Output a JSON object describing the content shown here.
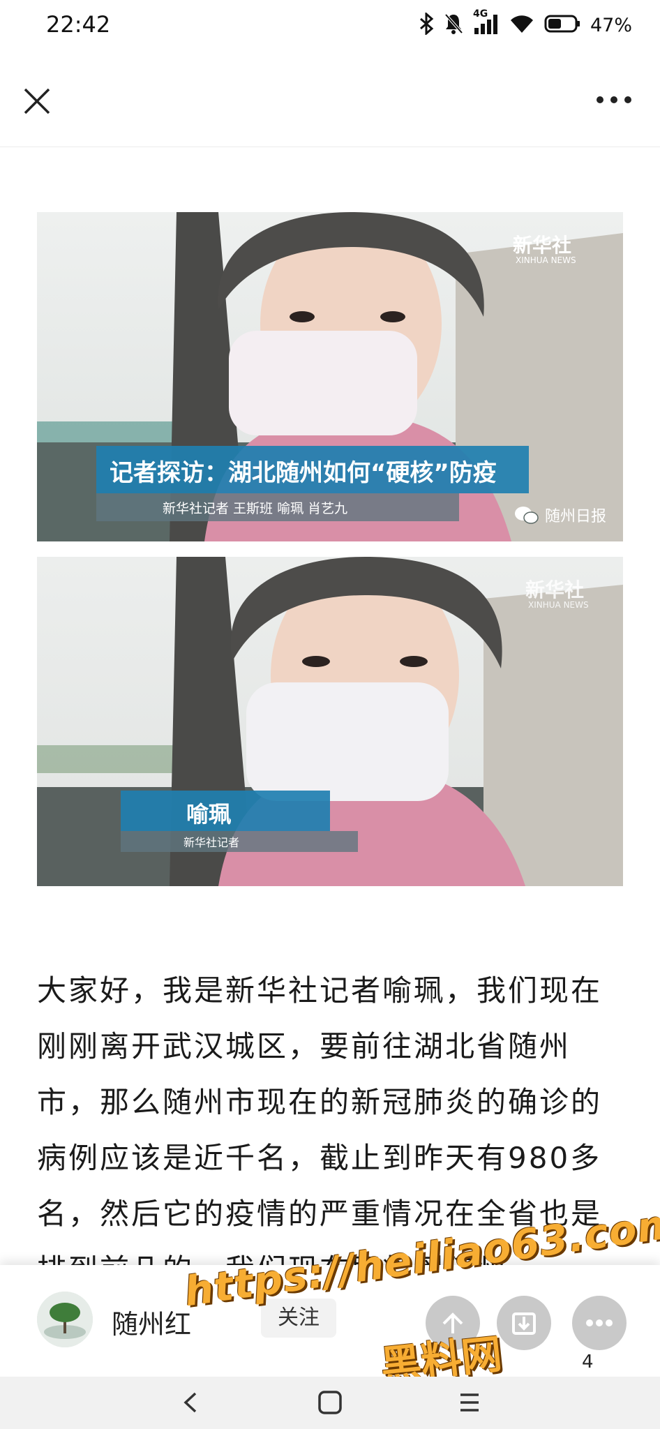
{
  "status_bar": {
    "time": "22:42",
    "network": "4G",
    "battery_percent": "47%",
    "icons": [
      "bluetooth-icon",
      "mute-icon",
      "signal-icon",
      "wifi-icon",
      "battery-icon"
    ]
  },
  "top_nav": {
    "close_icon": "close-icon",
    "more_icon": "more-icon"
  },
  "images": [
    {
      "logo": "新华社",
      "logo_sub": "XINHUA NEWS",
      "headline": "记者探访：湖北随州如何“硬核”防疫",
      "credits": "新华社记者 王斯班 喻珮 肖艺九",
      "source": "随州日报"
    },
    {
      "logo": "新华社",
      "logo_sub": "XINHUA NEWS",
      "name": "喻珮",
      "name_sub": "新华社记者"
    }
  ],
  "article": {
    "text": "大家好，我是新华社记者喻珮，我们现在刚刚离开武汉城区，要前往湖北省随州市，那么随州市现在的新冠肺炎的确诊的病例应该是近千名，截止到昨天有980多名，然后它的疫情的严重情况在全省也是排到前几的，我们现在即将到随州"
  },
  "bottom_bar": {
    "account_name": "随州红",
    "follow_label": "关注",
    "count_label": "4"
  },
  "watermark": {
    "url": "https://heiliao63.com",
    "site": "黑料网"
  },
  "colors": {
    "accent_blue": "#1f7fb0",
    "watermark_orange": "#f7ad33"
  }
}
